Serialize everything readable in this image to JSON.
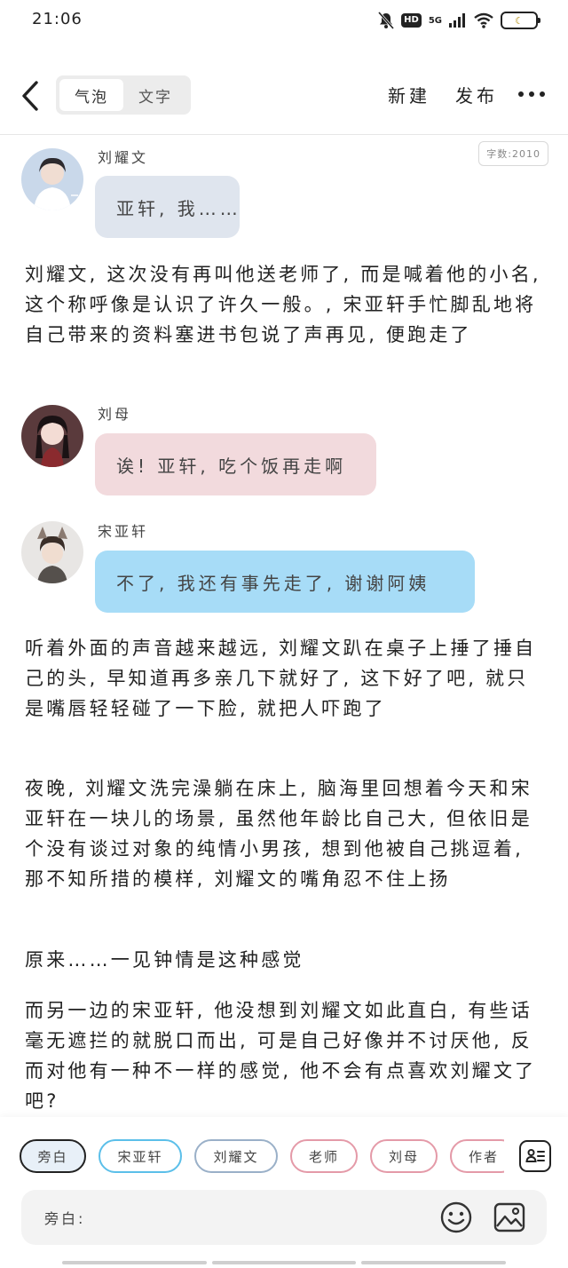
{
  "status_bar": {
    "time": "21:06",
    "hd": "HD",
    "network": "5G",
    "icons": [
      "mute-bell-icon",
      "signal-icon",
      "wifi-icon",
      "battery-icon"
    ],
    "battery_level": 0
  },
  "header": {
    "back_icon": "chevron-left-icon",
    "mode_options": [
      "气泡",
      "文字"
    ],
    "active_mode": "气泡",
    "new_label": "新建",
    "publish_label": "发布",
    "more_icon": "more-horizontal-icon"
  },
  "word_count": "字数:2010",
  "messages": [
    {
      "speaker": "刘耀文",
      "text": "亚轩, 我……",
      "bubble_color": "#dfe5ee"
    },
    {
      "speaker": "刘母",
      "text": "诶! 亚轩, 吃个饭再走啊",
      "bubble_color": "#f2dadd"
    },
    {
      "speaker": "宋亚轩",
      "text": "不了, 我还有事先走了, 谢谢阿姨",
      "bubble_color": "#a7dcf7"
    }
  ],
  "narrations": [
    "刘耀文, 这次没有再叫他送老师了, 而是喊着他的小名, 这个称呼像是认识了许久一般。, 宋亚轩手忙脚乱地将自己带来的资料塞进书包说了声再见, 便跑走了",
    "听着外面的声音越来越远, 刘耀文趴在桌子上捶了捶自己的头, 早知道再多亲几下就好了, 这下好了吧, 就只是嘴唇轻轻碰了一下脸, 就把人吓跑了",
    "夜晚, 刘耀文洗完澡躺在床上, 脑海里回想着今天和宋亚轩在一块儿的场景, 虽然他年龄比自己大, 但依旧是个没有谈过对象的纯情小男孩, 想到他被自己挑逗着, 那不知所措的模样, 刘耀文的嘴角忍不住上扬",
    "原来……一见钟情是这种感觉",
    "而另一边的宋亚轩, 他没想到刘耀文如此直白, 有些话毫无遮拦的就脱口而出, 可是自己好像并不讨厌他, 反而对他有一种不一样的感觉, 他不会有点喜欢刘耀文了吧?"
  ],
  "roles": [
    {
      "label": "旁白",
      "border": "#222222"
    },
    {
      "label": "宋亚轩",
      "border": "#5bbfe9"
    },
    {
      "label": "刘耀文",
      "border": "#9ab0c8"
    },
    {
      "label": "老师",
      "border": "#e49aa8"
    },
    {
      "label": "刘母",
      "border": "#e49aa8"
    },
    {
      "label": "作者",
      "border": "#e49aa8"
    }
  ],
  "role_manage_icon": "contact-card-icon",
  "input": {
    "prefix": "旁白:",
    "value": "",
    "emoji_icon": "smiley-icon",
    "image_icon": "image-icon"
  }
}
